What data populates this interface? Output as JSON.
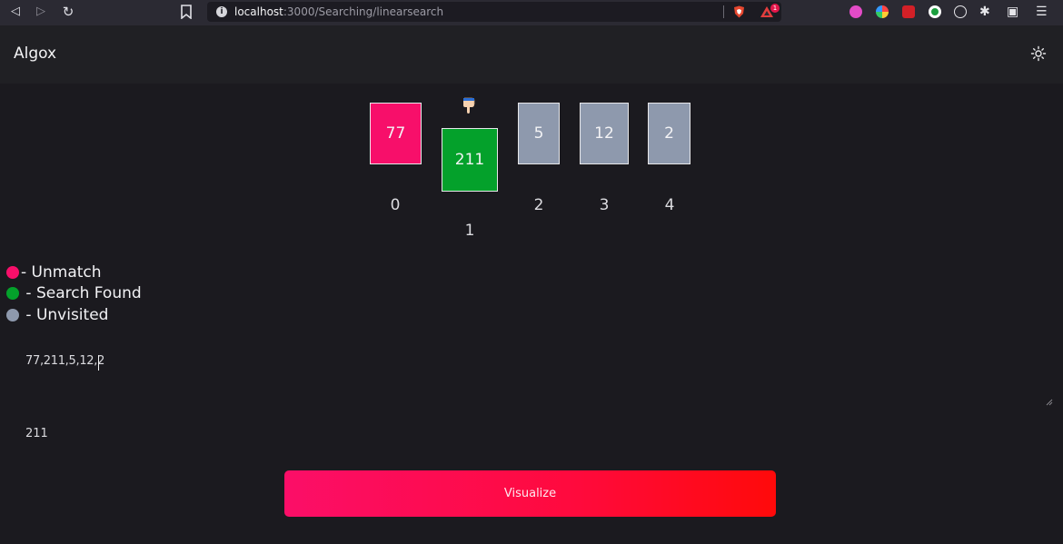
{
  "browser": {
    "url_host": "localhost",
    "url_path": ":3000/Searching/linearsearch",
    "rewards_badge": "1",
    "icons": {
      "back": "back-arrow-icon",
      "forward": "forward-arrow-icon",
      "reload": "reload-icon",
      "bookmark": "bookmark-icon",
      "site_info": "info-icon",
      "shields": "brave-shield-icon",
      "rewards": "brave-rewards-icon",
      "extensions": "puzzle-icon",
      "wallet": "wallet-icon",
      "menu": "hamburger-menu-icon"
    }
  },
  "header": {
    "title": "Algox",
    "theme_toggle_icon": "sun-icon"
  },
  "visualizer": {
    "bars": [
      {
        "value": "77",
        "index": "0",
        "state": "unmatch"
      },
      {
        "value": "211",
        "index": "1",
        "state": "found"
      },
      {
        "value": "5",
        "index": "2",
        "state": "unvisited"
      },
      {
        "value": "12",
        "index": "3",
        "state": "unvisited"
      },
      {
        "value": "2",
        "index": "4",
        "state": "unvisited"
      }
    ],
    "pointer_icon": "pointing-down-hand-icon",
    "pointer_at_index": 1
  },
  "legend": {
    "items": [
      {
        "label": "- Unmatch",
        "color": "#f70f6a"
      },
      {
        "label": " - Search Found",
        "color": "#04a12b"
      },
      {
        "label": " - Unvisited",
        "color": "#8e99ad"
      }
    ]
  },
  "form": {
    "array_value": "77,211,5,12,2",
    "target_value": "211",
    "visualize_label": "Visualize"
  },
  "colors": {
    "unmatch": "#f70f6a",
    "found": "#04a12b",
    "unvisited": "#8e99ad",
    "background": "#1b1a1f",
    "header": "#202024"
  }
}
